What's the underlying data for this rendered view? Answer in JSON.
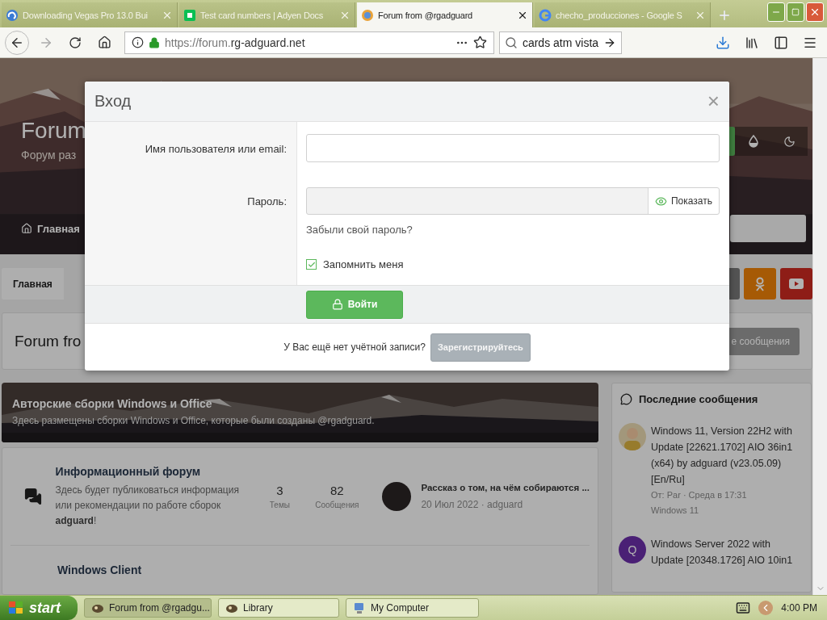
{
  "browser": {
    "tabs": [
      {
        "title": "Downloading Vegas Pro 13.0 Bui",
        "selected": false
      },
      {
        "title": "Test card numbers | Adyen Docs",
        "selected": false
      },
      {
        "title": "Forum from @rgadguard",
        "selected": true
      },
      {
        "title": "checho_producciones - Google S",
        "selected": false
      }
    ],
    "url_plain": "https://forum.",
    "url_domain": "rg-adguard.net",
    "search": "cards atm vista"
  },
  "page": {
    "header_title": "Forum",
    "header_subtitle": "Форум раз",
    "nav_item": "Главная",
    "breadcrumb": "Главная",
    "page_title": "Forum fro",
    "page_button": "е сообщения",
    "category": {
      "title": "Авторские сборки Windows и Office",
      "description": "Здесь размещены сборки Windows и Office, которые были созданы @rgadguard."
    },
    "forums": [
      {
        "title": "Информационный форум",
        "description": "Здесь будет публиковаться информация или рекомендации по работе сборок **adguard**!",
        "threads": "3",
        "threads_label": "Темы",
        "messages": "82",
        "messages_label": "Сообщения",
        "last_post": "Рассказ о том, на чём собираются ...",
        "last_meta": "20 Июл 2022 · adguard"
      },
      {
        "title": "Windows Client"
      }
    ],
    "sidebar": {
      "title": "Последние сообщения",
      "posts": [
        {
          "title": "Windows 11, Version 22H2 with Update [22621.1702] AIO 36in1 (x64) by adguard (v23.05.09) [En/Ru]",
          "meta": "От: Par · Среда в 17:31",
          "forum": "Windows 11"
        },
        {
          "title": "Windows Server 2022 with Update [20348.1726] AIO 10in1",
          "letter": "Q"
        }
      ]
    }
  },
  "modal": {
    "title": "Вход",
    "close": "×",
    "username_label": "Имя пользователя или email:",
    "password_label": "Пароль:",
    "show_password": "Показать",
    "forgot": "Забыли свой пароль?",
    "remember": {
      "label": "Запомнить меня",
      "checked": true
    },
    "submit": "Войти",
    "no_account": "У Вас ещё нет учётной записи?",
    "register": "Зарегистрируйтесь"
  },
  "taskbar": {
    "start": "start",
    "tasks": [
      {
        "title": "Forum from @rgadgu...",
        "selected": true
      },
      {
        "title": "Library",
        "selected": false
      },
      {
        "title": "My Computer",
        "selected": false
      }
    ],
    "clock": "4:00 PM"
  }
}
